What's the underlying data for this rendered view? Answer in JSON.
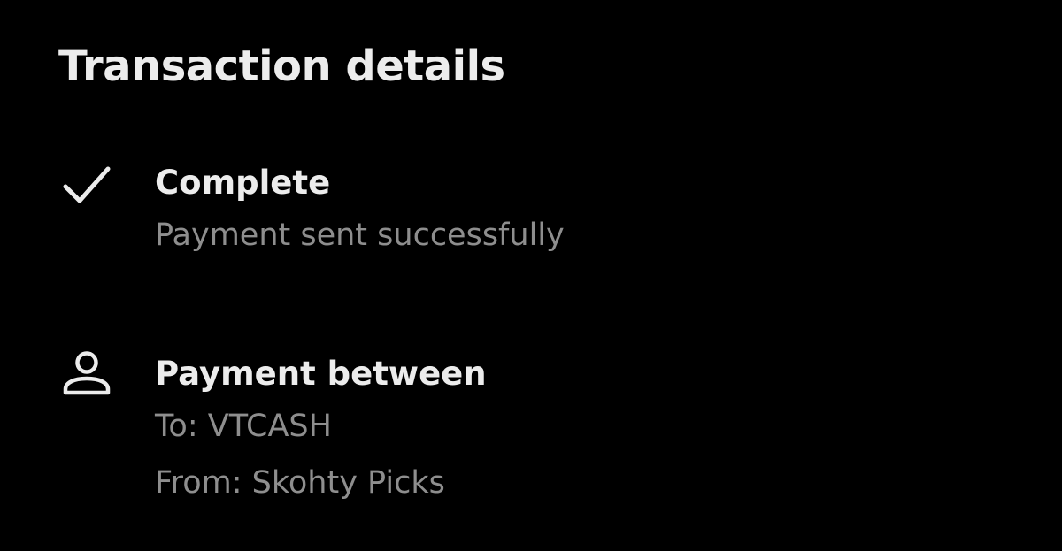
{
  "page": {
    "title": "Transaction details"
  },
  "status": {
    "icon": "checkmark-icon",
    "label": "Complete",
    "description": "Payment sent successfully"
  },
  "parties": {
    "icon": "person-icon",
    "label": "Payment between",
    "to": "To: VTCASH",
    "from": "From: Skohty Picks"
  },
  "colors": {
    "background": "#000000",
    "primary_text": "#ececec",
    "secondary_text": "#8e8e8e"
  }
}
